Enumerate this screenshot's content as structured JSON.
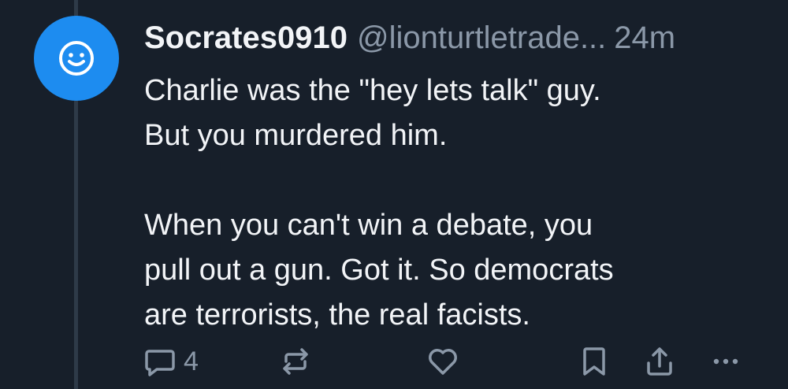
{
  "post": {
    "avatar_icon": "smiley-face-icon",
    "avatar_color": "#1d8cf0",
    "display_name": "Socrates0910",
    "handle": "@lionturtletrade...",
    "time": "24m",
    "text_lines": [
      "Charlie was the \"hey lets talk\" guy.",
      "But you murdered him.",
      "",
      "When you can't win a debate, you",
      "pull out a gun. Got it. So democrats",
      "are terrorists, the real facists."
    ]
  },
  "actions": {
    "reply": {
      "icon": "reply-bubble-icon",
      "count": "4"
    },
    "repost": {
      "icon": "repost-icon"
    },
    "like": {
      "icon": "heart-icon"
    },
    "bookmark": {
      "icon": "bookmark-icon"
    },
    "share": {
      "icon": "share-icon"
    },
    "more": {
      "icon": "more-dots-icon"
    }
  },
  "colors": {
    "background": "#171f2a",
    "text": "#f2f4f7",
    "muted": "#8b98a8",
    "thread_line": "#2e3a48"
  }
}
